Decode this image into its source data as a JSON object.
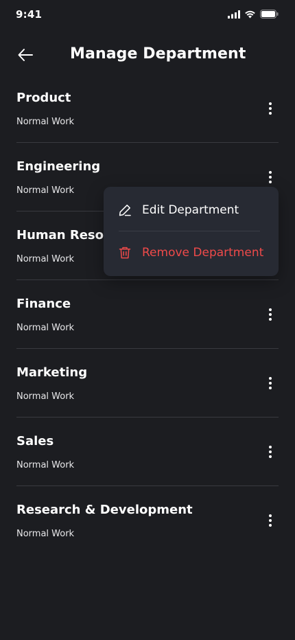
{
  "status_bar": {
    "time": "9:41"
  },
  "header": {
    "title": "Manage Department"
  },
  "departments": [
    {
      "name": "Product",
      "type": "Normal Work"
    },
    {
      "name": "Engineering",
      "type": "Normal Work"
    },
    {
      "name": "Human Resources",
      "type": "Normal Work"
    },
    {
      "name": "Finance",
      "type": "Normal Work"
    },
    {
      "name": "Marketing",
      "type": "Normal Work"
    },
    {
      "name": "Sales",
      "type": "Normal Work"
    },
    {
      "name": "Research & Development",
      "type": "Normal Work"
    }
  ],
  "context_menu": {
    "edit_label": "Edit Department",
    "remove_label": "Remove Department"
  },
  "colors": {
    "background": "#1c1d21",
    "menu_background": "#272a33",
    "danger": "#ef4a4a",
    "divider": "#393a40"
  }
}
